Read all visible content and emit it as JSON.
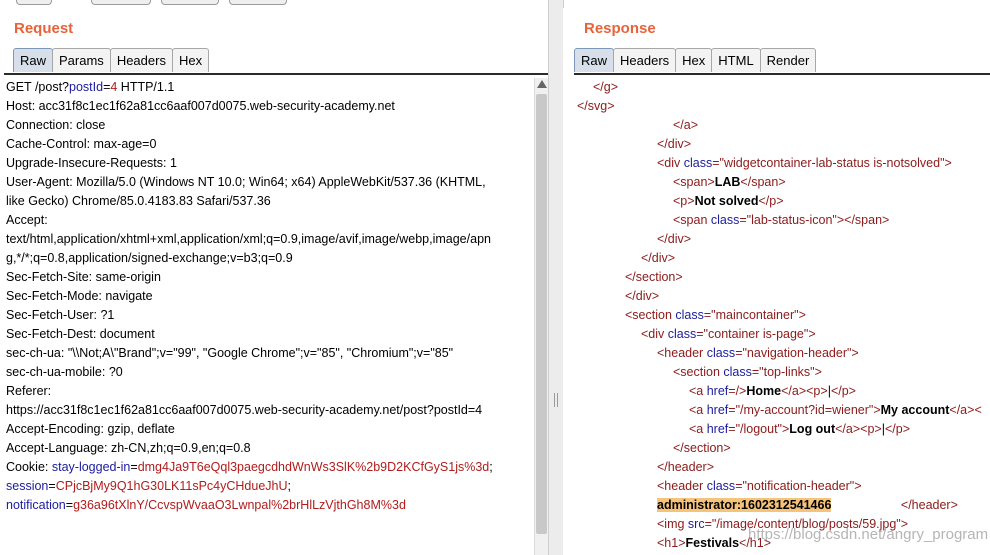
{
  "request": {
    "title": "Request",
    "tabs": [
      "Raw",
      "Params",
      "Headers",
      "Hex"
    ],
    "active_tab": "Raw",
    "lines": [
      [
        {
          "t": "GET /post?"
        },
        {
          "t": "postId",
          "c": "blue"
        },
        {
          "t": "="
        },
        {
          "t": "4",
          "c": "red"
        },
        {
          "t": " HTTP/1.1"
        }
      ],
      [
        {
          "t": "Host: acc31f8c1ec1f62a81cc6aaf007d0075.web-security-academy.net"
        }
      ],
      [
        {
          "t": "Connection: close"
        }
      ],
      [
        {
          "t": "Cache-Control: max-age=0"
        }
      ],
      [
        {
          "t": "Upgrade-Insecure-Requests: 1"
        }
      ],
      [
        {
          "t": "User-Agent: Mozilla/5.0 (Windows NT 10.0; Win64; x64) AppleWebKit/537.36 (KHTML,"
        }
      ],
      [
        {
          "t": "like Gecko) Chrome/85.0.4183.83 Safari/537.36"
        }
      ],
      [
        {
          "t": "Accept:"
        }
      ],
      [
        {
          "t": "text/html,application/xhtml+xml,application/xml;q=0.9,image/avif,image/webp,image/apn"
        }
      ],
      [
        {
          "t": "g,*/*;q=0.8,application/signed-exchange;v=b3;q=0.9"
        }
      ],
      [
        {
          "t": "Sec-Fetch-Site: same-origin"
        }
      ],
      [
        {
          "t": "Sec-Fetch-Mode: navigate"
        }
      ],
      [
        {
          "t": "Sec-Fetch-User: ?1"
        }
      ],
      [
        {
          "t": "Sec-Fetch-Dest: document"
        }
      ],
      [
        {
          "t": "sec-ch-ua: \"\\\\Not;A\\\"Brand\";v=\"99\", \"Google Chrome\";v=\"85\", \"Chromium\";v=\"85\""
        }
      ],
      [
        {
          "t": "sec-ch-ua-mobile: ?0"
        }
      ],
      [
        {
          "t": "Referer:"
        }
      ],
      [
        {
          "t": "https://acc31f8c1ec1f62a81cc6aaf007d0075.web-security-academy.net/post?postId=4"
        }
      ],
      [
        {
          "t": "Accept-Encoding: gzip, deflate"
        }
      ],
      [
        {
          "t": "Accept-Language: zh-CN,zh;q=0.9,en;q=0.8"
        }
      ],
      [
        {
          "t": "Cookie: "
        },
        {
          "t": "stay-logged-in",
          "c": "blue"
        },
        {
          "t": "="
        },
        {
          "t": "dmg4Ja9T6eQql3paegcdhdWnWs3SlK%2b9D2KCfGyS1js%3d",
          "c": "red"
        },
        {
          "t": ";"
        }
      ],
      [
        {
          "t": "session",
          "c": "blue"
        },
        {
          "t": "="
        },
        {
          "t": "CPjcBjMy9Q1hG30LK11sPc4yCHdueJhU",
          "c": "red"
        },
        {
          "t": ";"
        }
      ],
      [
        {
          "t": "notification",
          "c": "blue"
        },
        {
          "t": "="
        },
        {
          "t": "g36a96tXlnY/CcvspWvaaO3Lwnpal%2brHlLzVjthGh8M%3d",
          "c": "red"
        }
      ]
    ]
  },
  "response": {
    "title": "Response",
    "tabs": [
      "Raw",
      "Headers",
      "Hex",
      "HTML",
      "Render"
    ],
    "active_tab": "Raw",
    "lines": [
      {
        "i": 1,
        "s": [
          {
            "t": "</g>",
            "c": "tag"
          }
        ]
      },
      {
        "i": 0,
        "s": [
          {
            "t": "</svg>",
            "c": "tag"
          }
        ]
      },
      {
        "i": 6,
        "s": [
          {
            "t": "</a>",
            "c": "tag"
          }
        ]
      },
      {
        "i": 5,
        "s": [
          {
            "t": "</div>",
            "c": "tag"
          }
        ]
      },
      {
        "i": 5,
        "s": [
          {
            "t": "<div ",
            "c": "tag"
          },
          {
            "t": "class",
            "c": "attr"
          },
          {
            "t": "=\"widgetcontainer-lab-status is-notsolved\">",
            "c": "tag"
          }
        ]
      },
      {
        "i": 6,
        "s": [
          {
            "t": "<span>",
            "c": "tag"
          },
          {
            "t": "LAB",
            "c": "bold"
          },
          {
            "t": "</span>",
            "c": "tag"
          }
        ]
      },
      {
        "i": 6,
        "s": [
          {
            "t": "<p>",
            "c": "tag"
          },
          {
            "t": "Not solved",
            "c": "bold"
          },
          {
            "t": "</p>",
            "c": "tag"
          }
        ]
      },
      {
        "i": 6,
        "s": [
          {
            "t": "<span ",
            "c": "tag"
          },
          {
            "t": "class",
            "c": "attr"
          },
          {
            "t": "=\"lab-status-icon\">",
            "c": "tag"
          },
          {
            "t": "</span>",
            "c": "tag"
          }
        ]
      },
      {
        "i": 5,
        "s": [
          {
            "t": "</div>",
            "c": "tag"
          }
        ]
      },
      {
        "i": 4,
        "s": [
          {
            "t": "</div>",
            "c": "tag"
          }
        ]
      },
      {
        "i": 3,
        "s": [
          {
            "t": "</section>",
            "c": "tag"
          }
        ]
      },
      {
        "i": 3,
        "s": [
          {
            "t": "</div>",
            "c": "tag"
          }
        ]
      },
      {
        "i": 3,
        "s": [
          {
            "t": "<section ",
            "c": "tag"
          },
          {
            "t": "class",
            "c": "attr"
          },
          {
            "t": "=\"maincontainer\">",
            "c": "tag"
          }
        ]
      },
      {
        "i": 4,
        "s": [
          {
            "t": "<div ",
            "c": "tag"
          },
          {
            "t": "class",
            "c": "attr"
          },
          {
            "t": "=\"container is-page\">",
            "c": "tag"
          }
        ]
      },
      {
        "i": 5,
        "s": [
          {
            "t": "<header ",
            "c": "tag"
          },
          {
            "t": "class",
            "c": "attr"
          },
          {
            "t": "=\"navigation-header\">",
            "c": "tag"
          }
        ]
      },
      {
        "i": 6,
        "s": [
          {
            "t": "<section ",
            "c": "tag"
          },
          {
            "t": "class",
            "c": "attr"
          },
          {
            "t": "=\"top-links\">",
            "c": "tag"
          }
        ]
      },
      {
        "i": 7,
        "s": [
          {
            "t": "<a ",
            "c": "tag"
          },
          {
            "t": "href",
            "c": "attr"
          },
          {
            "t": "=/>",
            "c": "tag"
          },
          {
            "t": "Home",
            "c": "bold"
          },
          {
            "t": "</a>",
            "c": "tag"
          },
          {
            "t": "<p>",
            "c": "tag"
          },
          {
            "t": "|"
          },
          {
            "t": "</p>",
            "c": "tag"
          }
        ]
      },
      {
        "i": 7,
        "s": [
          {
            "t": "<a ",
            "c": "tag"
          },
          {
            "t": "href",
            "c": "attr"
          },
          {
            "t": "=\"/my-account?id=wiener\">",
            "c": "tag"
          },
          {
            "t": "My account",
            "c": "bold"
          },
          {
            "t": "</a>",
            "c": "tag"
          },
          {
            "t": "<",
            "c": "tag"
          }
        ]
      },
      {
        "i": 7,
        "s": [
          {
            "t": "<a ",
            "c": "tag"
          },
          {
            "t": "href",
            "c": "attr"
          },
          {
            "t": "=\"/logout\">",
            "c": "tag"
          },
          {
            "t": "Log out",
            "c": "bold"
          },
          {
            "t": "</a>",
            "c": "tag"
          },
          {
            "t": "<p>",
            "c": "tag"
          },
          {
            "t": "|"
          },
          {
            "t": "</p>",
            "c": "tag"
          }
        ]
      },
      {
        "i": 6,
        "s": [
          {
            "t": "</section>",
            "c": "tag"
          }
        ]
      },
      {
        "i": 5,
        "s": [
          {
            "t": "</header>",
            "c": "tag"
          }
        ]
      },
      {
        "i": 5,
        "s": [
          {
            "t": "<header ",
            "c": "tag"
          },
          {
            "t": "class",
            "c": "attr"
          },
          {
            "t": "=\"notification-header\">",
            "c": "tag"
          }
        ]
      },
      {
        "i": 5,
        "s": [
          {
            "t": "administrator:1602312541466",
            "c": "hl"
          },
          {
            "t": "                    "
          },
          {
            "t": "</header>",
            "c": "tag"
          }
        ]
      },
      {
        "i": 5,
        "s": [
          {
            "t": "<img ",
            "c": "tag"
          },
          {
            "t": "src",
            "c": "attr"
          },
          {
            "t": "=\"/image/content/blog/posts/59.jpg\">",
            "c": "tag"
          }
        ]
      },
      {
        "i": 5,
        "s": [
          {
            "t": "<h1>",
            "c": "tag"
          },
          {
            "t": "Festivals",
            "c": "bold"
          },
          {
            "t": "</h1>",
            "c": "tag"
          }
        ]
      }
    ]
  },
  "watermark": "https://blog.csdn.net/angry_program"
}
